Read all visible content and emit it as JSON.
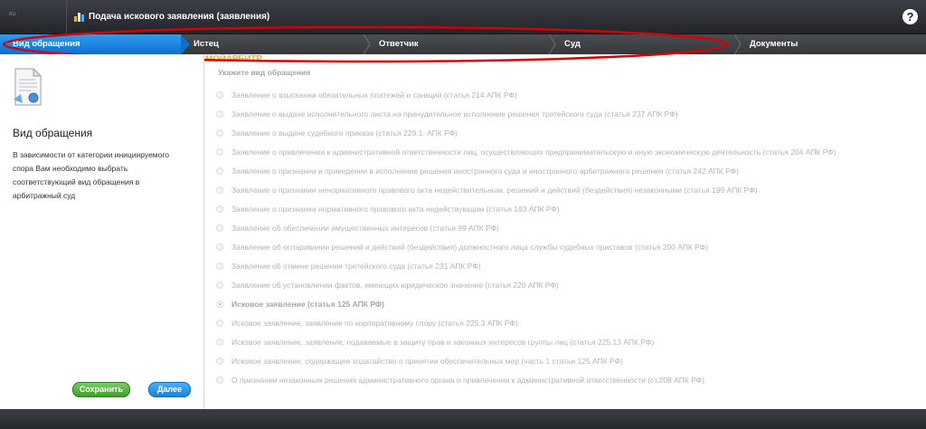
{
  "app": {
    "logo": "МОЙАРБИТР",
    "logo_sup": "RU",
    "title": "Подача искового заявления (заявления)",
    "help_label": "?"
  },
  "steps": [
    {
      "label": "Вид обращения",
      "active": true
    },
    {
      "label": "Истец",
      "active": false
    },
    {
      "label": "Ответчик",
      "active": false
    },
    {
      "label": "Суд",
      "active": false
    },
    {
      "label": "Документы",
      "active": false
    }
  ],
  "sidebar": {
    "title": "Вид обращения",
    "description": "В зависимости от категории инициируемого спора Вам необходимо выбрать соответствующий вид обращения в арбитражный суд",
    "save_label": "Сохранить",
    "next_label": "Далее"
  },
  "main": {
    "section_title": "Укажите вид обращения",
    "options": [
      {
        "label": "Заявление о взыскании обязательных платежей и санкций (статья 214 АПК РФ)",
        "selected": false
      },
      {
        "label": "Заявление о выдаче исполнительного листа на принудительное исполнение решения третейского суда (статья 237 АПК РФ)",
        "selected": false
      },
      {
        "label": "Заявление о выдаче судебного приказа (статья 229.1. АПК РФ)",
        "selected": false
      },
      {
        "label": "Заявление о привлечении к административной ответственности лиц, осуществляющих предпринимательскую и иную экономическую деятельность (статья 204 АПК РФ)",
        "selected": false
      },
      {
        "label": "Заявление о признании и приведении в исполнение решения иностранного суда и иностранного арбитражного решения (статья 242 АПК РФ)",
        "selected": false
      },
      {
        "label": "Заявление о признании ненормативного правового акта недействительным, решений и действий (бездействия) незаконными (статья 199 АПК РФ)",
        "selected": false
      },
      {
        "label": "Заявление о признании нормативного правового акта недействующим (статья 193 АПК РФ)",
        "selected": false
      },
      {
        "label": "Заявление об обеспечении имущественных интересов (статья 99 АПК РФ)",
        "selected": false
      },
      {
        "label": "Заявление об оспаривании решений и действий (бездействия) должностного лица службы судебных приставов (статья 200 АПК РФ)",
        "selected": false
      },
      {
        "label": "Заявление об отмене решения третейского суда (статья 231 АПК РФ)",
        "selected": false
      },
      {
        "label": "Заявление об установлении фактов, имеющих юридическое значение (статья 220 АПК РФ)",
        "selected": false
      },
      {
        "label": "Исковое заявление (статья 125 АПК РФ)",
        "selected": true
      },
      {
        "label": "Исковое заявление, заявление по корпоративному спору (статья 225.3 АПК РФ)",
        "selected": false
      },
      {
        "label": "Исковое заявление, заявление, подаваемые в защиту прав и законных интересов группы лиц (статья 225.13 АПК РФ)",
        "selected": false
      },
      {
        "label": "Исковое заявление, содержащее ходатайство о принятии обеспечительных мер (часть 1 статьи 125 АПК РФ)",
        "selected": false
      },
      {
        "label": "О признании незаконным решения административного органа о привлечении к административной ответственности (ст.208 АПК РФ)",
        "selected": false
      }
    ]
  },
  "colors": {
    "active_step": "#1a80e0",
    "annotation": "#d40000",
    "save_button": "#4caf3a",
    "next_button": "#2a90e6"
  }
}
